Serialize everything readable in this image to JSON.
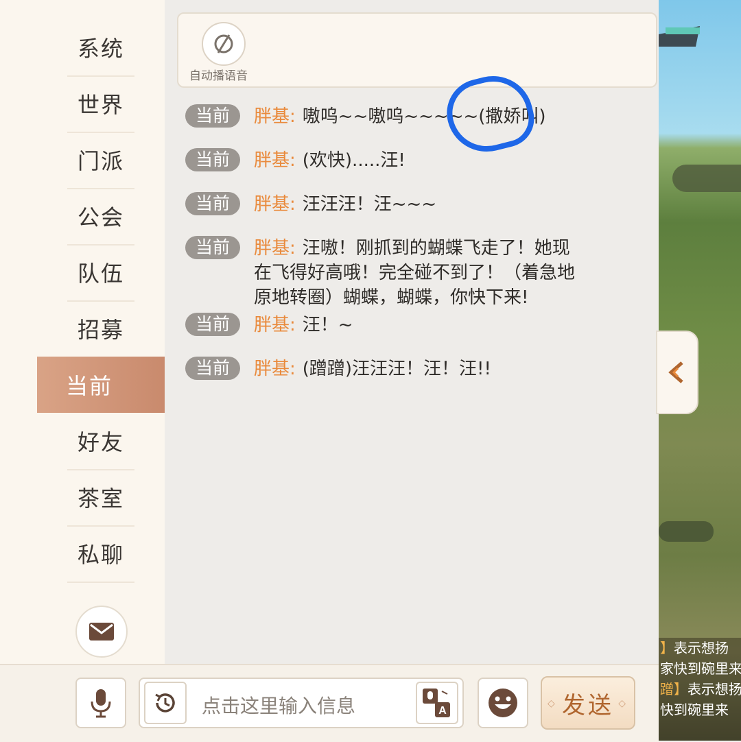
{
  "sidebar": {
    "items": [
      {
        "label": "系统",
        "active": false
      },
      {
        "label": "世界",
        "active": false
      },
      {
        "label": "门派",
        "active": false
      },
      {
        "label": "公会",
        "active": false
      },
      {
        "label": "队伍",
        "active": false
      },
      {
        "label": "招募",
        "active": false
      },
      {
        "label": "当前",
        "active": true
      },
      {
        "label": "好友",
        "active": false
      },
      {
        "label": "茶室",
        "active": false
      },
      {
        "label": "私聊",
        "active": false
      }
    ],
    "mail_icon": "mail-icon"
  },
  "top_card": {
    "voice_icon": "voice-off-icon",
    "voice_label": "自动播语音"
  },
  "messages": [
    {
      "channel": "当前",
      "speaker": "胖基:",
      "text": "嗷呜~~嗷呜~~~~~(撒娇叫)"
    },
    {
      "channel": "当前",
      "speaker": "胖基:",
      "text": "(欢快).....汪!"
    },
    {
      "channel": "当前",
      "speaker": "胖基:",
      "text": "汪汪汪！汪~~~"
    },
    {
      "channel": "当前",
      "speaker": "胖基:",
      "text": "汪嗷！刚抓到的蝴蝶飞走了！她现在飞得好高哦！完全碰不到了！（着急地原地转圈）蝴蝶，蝴蝶，你快下来!"
    },
    {
      "channel": "当前",
      "speaker": "胖基:",
      "text": "汪！~"
    },
    {
      "channel": "当前",
      "speaker": "胖基:",
      "text": "(蹭蹭)汪汪汪！汪！汪!!"
    }
  ],
  "input": {
    "placeholder": "点击这里输入信息",
    "history_icon": "history-icon",
    "translate_icon": "translate-icon"
  },
  "toolbar": {
    "mic_icon": "microphone-icon",
    "emoji_icon": "emoji-icon",
    "send_label": "发送",
    "collapse_icon": "chevron-left-icon"
  },
  "game_log": {
    "lines": [
      {
        "tag": "】",
        "text": "表示想扬"
      },
      {
        "tag": "",
        "text": "家快到碗里来"
      },
      {
        "tag": "蹭】",
        "text": "表示想扬"
      },
      {
        "tag": "",
        "text": "快到碗里来"
      }
    ]
  },
  "colors": {
    "accent": "#e98a3c",
    "active_tab": "#d9a386",
    "annotation": "#1e67e8",
    "badge": "#9b9691"
  }
}
